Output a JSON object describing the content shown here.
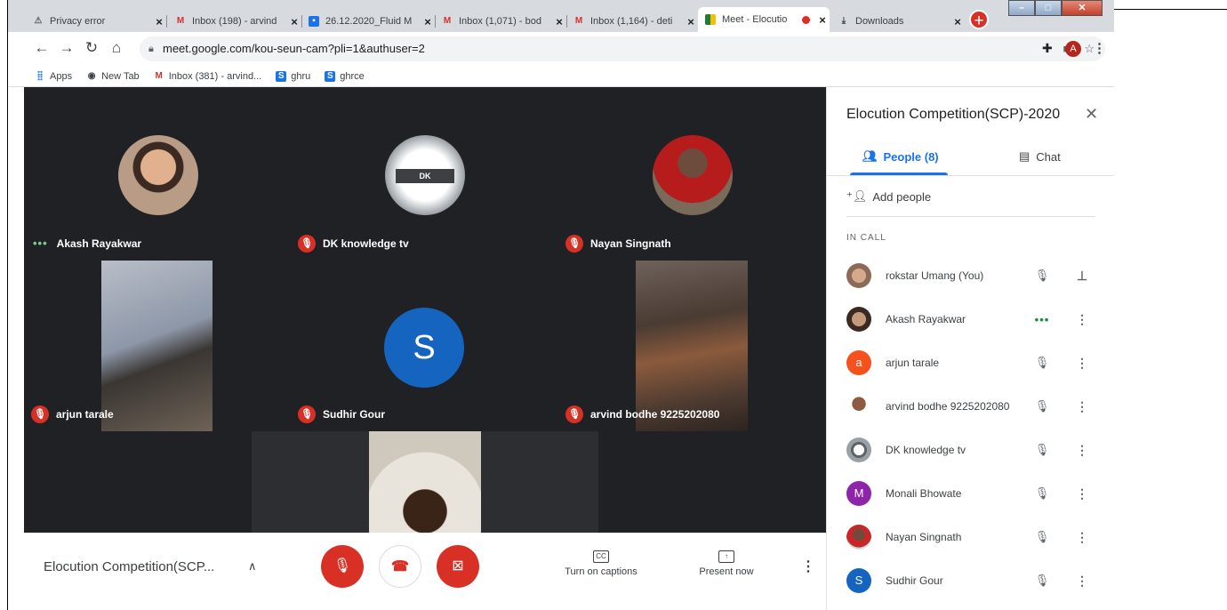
{
  "browser": {
    "tabs": [
      {
        "title": "Privacy error",
        "icon": "warning-icon"
      },
      {
        "title": "Inbox (198) - arvind",
        "icon": "gmail-icon"
      },
      {
        "title": "26.12.2020_Fluid M",
        "icon": "calendar-icon"
      },
      {
        "title": "Inbox (1,071) - bod",
        "icon": "gmail-icon"
      },
      {
        "title": "Inbox (1,164) - deti",
        "icon": "gmail-icon"
      },
      {
        "title": "Meet - Elocutio",
        "icon": "meet-icon",
        "active": true,
        "recording": true
      },
      {
        "title": "Downloads",
        "icon": "download-icon"
      }
    ],
    "url": "meet.google.com/kou-seun-cam?pli=1&authuser=2",
    "profile_initial": "A",
    "bookmarks": [
      {
        "label": "Apps",
        "icon": "apps-grid-icon"
      },
      {
        "label": "New Tab",
        "icon": "globe-icon"
      },
      {
        "label": "Inbox (381) - arvind...",
        "icon": "gmail-icon"
      },
      {
        "label": "ghru",
        "icon": "s-icon"
      },
      {
        "label": "ghrce",
        "icon": "s-icon"
      }
    ]
  },
  "meeting": {
    "title_truncated": "Elocution Competition(SCP...",
    "tiles": [
      {
        "name": "Akash Rayakwar",
        "status": "speaking"
      },
      {
        "name": "DK knowledge tv",
        "status": "muted"
      },
      {
        "name": "Nayan Singnath",
        "status": "muted"
      },
      {
        "name": "arjun tarale",
        "status": "muted"
      },
      {
        "name": "Sudhir Gour",
        "status": "muted",
        "initial": "S"
      },
      {
        "name": "arvind bodhe 9225202080",
        "status": "muted"
      }
    ],
    "controls": {
      "captions_label": "Turn on captions",
      "captions_icon_text": "CC",
      "present_label": "Present now"
    }
  },
  "panel": {
    "title": "Elocution Competition(SCP)-2020",
    "tab_people": "People (8)",
    "tab_chat": "Chat",
    "add_people": "Add people",
    "section_label": "IN CALL",
    "people": [
      {
        "name": "rokstar Umang (You)",
        "status": "muted",
        "action": "pin"
      },
      {
        "name": "Akash Rayakwar",
        "status": "speaking",
        "action": "more"
      },
      {
        "name": "arjun tarale",
        "status": "muted",
        "action": "more",
        "initial": "a",
        "color": "#f4511e"
      },
      {
        "name": "arvind bodhe 9225202080",
        "status": "muted",
        "action": "more"
      },
      {
        "name": "DK knowledge tv",
        "status": "muted",
        "action": "more"
      },
      {
        "name": "Monali Bhowate",
        "status": "muted",
        "action": "more",
        "initial": "M",
        "color": "#8e24aa"
      },
      {
        "name": "Nayan Singnath",
        "status": "muted",
        "action": "more"
      },
      {
        "name": "Sudhir Gour",
        "status": "muted",
        "action": "more",
        "initial": "S",
        "color": "#1565c0"
      }
    ]
  },
  "colors": {
    "accent": "#1a73e8",
    "danger": "#d93025",
    "meet_bg": "#202124"
  }
}
